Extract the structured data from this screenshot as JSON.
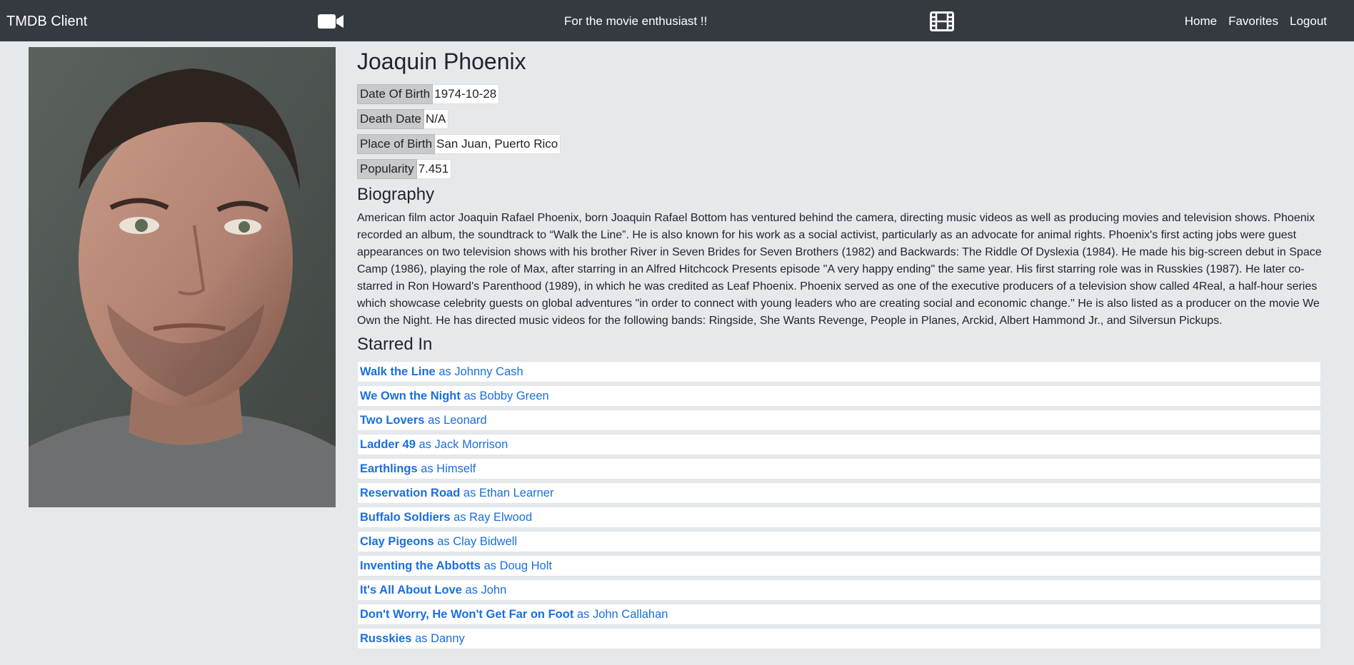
{
  "navbar": {
    "brand": "TMDB Client",
    "camera_icon": "video-camera-icon",
    "tagline": "For the movie enthusiast !!",
    "film_icon": "film-strip-icon",
    "links": [
      "Home",
      "Favorites",
      "Logout"
    ]
  },
  "person": {
    "name": "Joaquin Phoenix",
    "photo_alt": "profile-photo",
    "details": [
      {
        "label": "Date Of Birth",
        "value": "1974-10-28"
      },
      {
        "label": "Death Date",
        "value": "N/A"
      },
      {
        "label": "Place of Birth",
        "value": "San Juan, Puerto Rico"
      },
      {
        "label": "Popularity",
        "value": "7.451"
      }
    ],
    "biography_heading": "Biography",
    "biography": "American film actor Joaquin Rafael Phoenix, born Joaquin Rafael Bottom has ventured behind the camera, directing music videos as well as producing movies and television shows. Phoenix recorded an album, the soundtrack to “Walk the Line”. He is also known for his work as a social activist, particularly as an advocate for animal rights. Phoenix's first acting jobs were guest appearances on two television shows with his brother River in Seven Brides for Seven Brothers (1982) and Backwards: The Riddle Of Dyslexia (1984). He made his big-screen debut in Space Camp (1986), playing the role of Max, after starring in an Alfred Hitchcock Presents episode \"A very happy ending\" the same year. His first starring role was in Russkies (1987). He later co-starred in Ron Howard's Parenthood (1989), in which he was credited as Leaf Phoenix. Phoenix served as one of the executive producers of a television show called 4Real, a half-hour series which showcase celebrity guests on global adventures \"in order to connect with young leaders who are creating social and economic change.\" He is also listed as a producer on the movie We Own the Night. He has directed music videos for the following bands: Ringside, She Wants Revenge, People in Planes, Arckid, Albert Hammond Jr., and Silversun Pickups.",
    "starred_heading": "Starred In",
    "films": [
      {
        "title": "Walk the Line",
        "role": "as Johnny Cash"
      },
      {
        "title": "We Own the Night",
        "role": "as Bobby Green"
      },
      {
        "title": "Two Lovers",
        "role": "as Leonard"
      },
      {
        "title": "Ladder 49",
        "role": "as Jack Morrison"
      },
      {
        "title": "Earthlings",
        "role": "as Himself"
      },
      {
        "title": "Reservation Road",
        "role": "as Ethan Learner"
      },
      {
        "title": "Buffalo Soldiers",
        "role": "as Ray Elwood"
      },
      {
        "title": "Clay Pigeons",
        "role": "as Clay Bidwell"
      },
      {
        "title": "Inventing the Abbotts",
        "role": "as Doug Holt"
      },
      {
        "title": "It's All About Love",
        "role": "as John"
      },
      {
        "title": "Don't Worry, He Won't Get Far on Foot",
        "role": "as John Callahan"
      },
      {
        "title": "Russkies",
        "role": "as Danny"
      }
    ]
  }
}
